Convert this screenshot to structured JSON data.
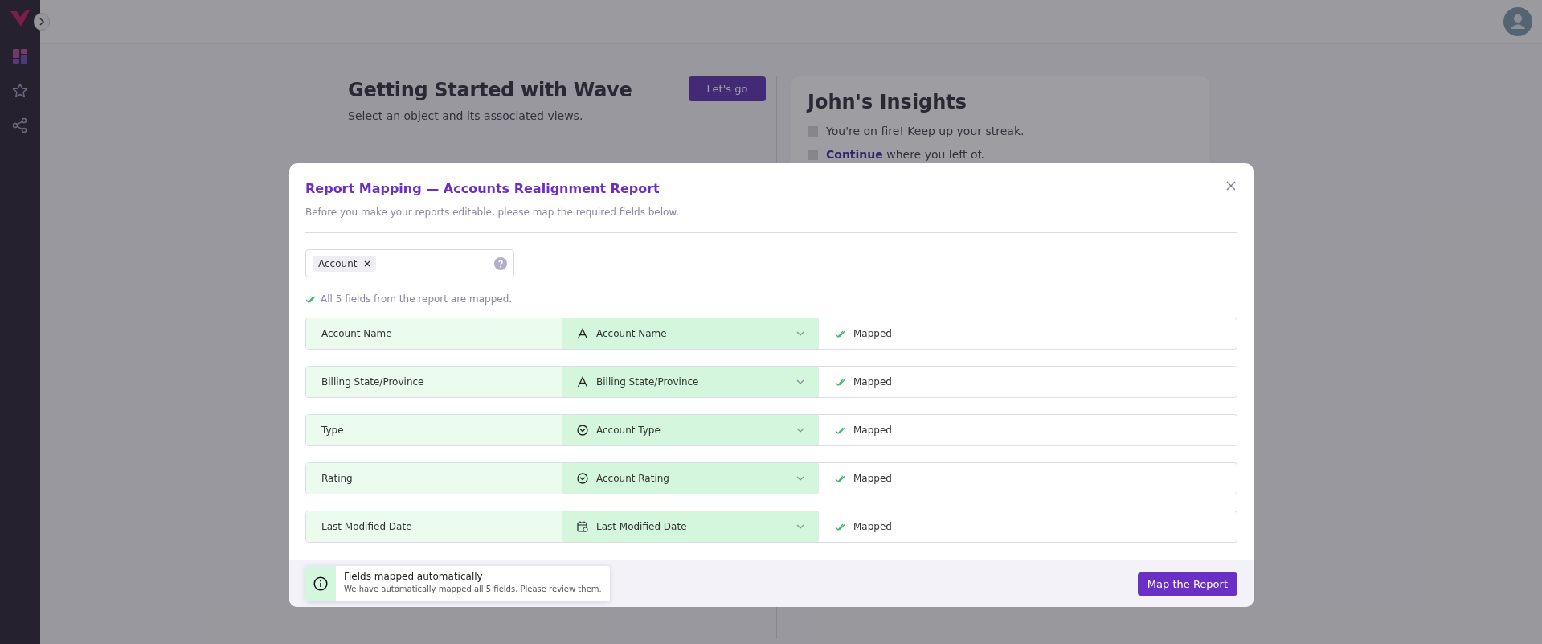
{
  "sidebar": {
    "items": [
      {
        "kind": "dashboard",
        "selected": true
      },
      {
        "kind": "star",
        "selected": false
      },
      {
        "kind": "share",
        "selected": false
      }
    ]
  },
  "getting_started": {
    "title": "Getting Started with Wave",
    "subtitle": "Select an object and its associated views.",
    "button": "Let's go"
  },
  "insights": {
    "title": "John's Insights",
    "items": [
      {
        "text": "You're on fire! Keep up your streak."
      },
      {
        "text": "**Continue** where you left of."
      }
    ]
  },
  "modal": {
    "title": "Report Mapping — Accounts Realignment Report",
    "subtitle": "Before you make your reports editable, please map the required fields below.",
    "tags": [
      "Account"
    ],
    "status_message": "All 5 fields from the report are mapped.",
    "rows": [
      {
        "source": "Account Name",
        "target": "Account Name",
        "kind": "text",
        "status": "Mapped"
      },
      {
        "source": "Billing State/Province",
        "target": "Billing State/Province",
        "kind": "text",
        "status": "Mapped"
      },
      {
        "source": "Type",
        "target": "Account Type",
        "kind": "picklist",
        "status": "Mapped"
      },
      {
        "source": "Rating",
        "target": "Account Rating",
        "kind": "picklist",
        "status": "Mapped"
      },
      {
        "source": "Last Modified Date",
        "target": "Last Modified Date",
        "kind": "date",
        "status": "Mapped"
      }
    ],
    "toast": {
      "title": "Fields mapped automatically",
      "message": "We have automatically mapped all 5 fields. Please review them."
    },
    "button": "Map the Report"
  }
}
